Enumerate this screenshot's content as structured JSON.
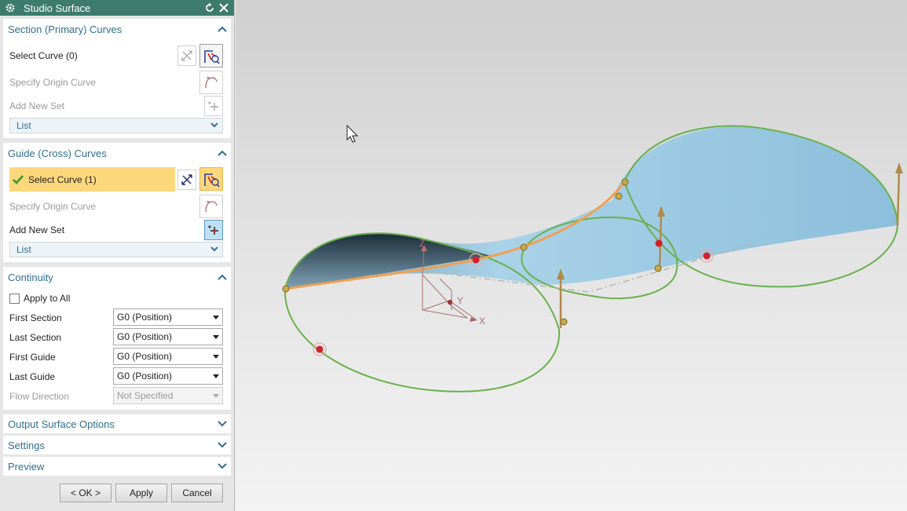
{
  "dialog": {
    "title": "Studio Surface",
    "section_curves": {
      "header": "Section (Primary) Curves",
      "select_curve": "Select Curve (0)",
      "specify_origin": "Specify Origin Curve",
      "add_new_set": "Add New Set",
      "list": "List"
    },
    "guide_curves": {
      "header": "Guide (Cross) Curves",
      "select_curve": "Select Curve (1)",
      "specify_origin": "Specify Origin Curve",
      "add_new_set": "Add New Set",
      "list": "List"
    },
    "continuity": {
      "header": "Continuity",
      "apply_to_all": "Apply to All",
      "rows": [
        {
          "label": "First Section",
          "value": "G0 (Position)"
        },
        {
          "label": "Last Section",
          "value": "G0 (Position)"
        },
        {
          "label": "First Guide",
          "value": "G0 (Position)"
        },
        {
          "label": "Last Guide",
          "value": "G0 (Position)"
        },
        {
          "label": "Flow Direction",
          "value": "Not Specified"
        }
      ]
    },
    "output_surface_options": "Output Surface Options",
    "settings": "Settings",
    "preview": "Preview",
    "buttons": {
      "ok": "< OK >",
      "apply": "Apply",
      "cancel": "Cancel"
    }
  },
  "viewport": {
    "axis_labels": {
      "x": "X",
      "y": "Y",
      "z": "Z"
    }
  },
  "colors": {
    "titlebar": "#3d7c6c",
    "header_text": "#2f6f8f",
    "highlight": "#fdd77b",
    "surface": "#8fc3de",
    "edge": "#6ab04c",
    "guide_curve": "#f0a050",
    "handle_point": "#d4202a"
  }
}
